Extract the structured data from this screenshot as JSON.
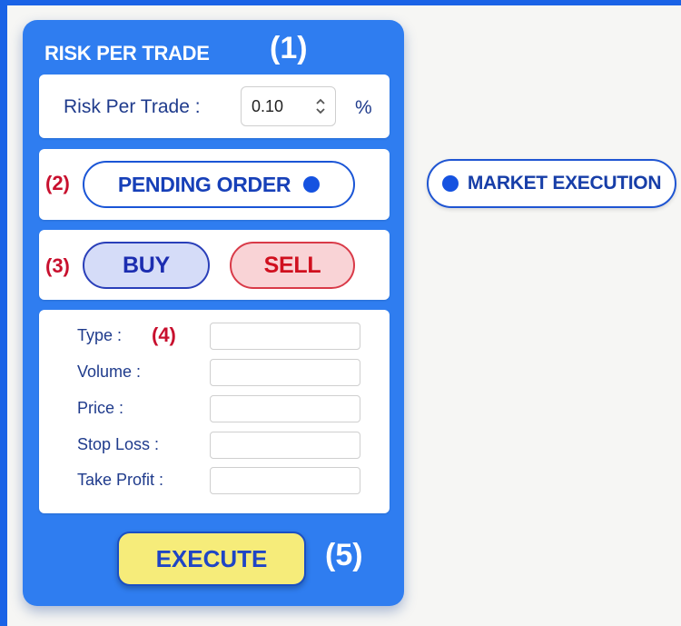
{
  "panel": {
    "title": "RISK PER TRADE",
    "markers": [
      "(1)",
      "(2)",
      "(3)",
      "(4)",
      "(5)"
    ]
  },
  "risk": {
    "label": "Risk Per Trade :",
    "value": "0.10",
    "unit": "%"
  },
  "order_mode": {
    "pending_label": "PENDING ORDER",
    "market_label": "MARKET EXECUTION"
  },
  "direction": {
    "buy_label": "BUY",
    "sell_label": "SELL"
  },
  "fields": [
    {
      "label": "Type :",
      "value": ""
    },
    {
      "label": "Volume :",
      "value": ""
    },
    {
      "label": "Price :",
      "value": ""
    },
    {
      "label": "Stop Loss :",
      "value": ""
    },
    {
      "label": "Take Profit :",
      "value": ""
    }
  ],
  "execute_label": "EXECUTE",
  "colors": {
    "panel": "#2f7df0",
    "frame": "#1a63e6",
    "execute": "#f6ec7a",
    "buy_fill": "#d5dcf8",
    "sell_fill": "#f9d3d6",
    "marker_red": "#c8102e"
  }
}
